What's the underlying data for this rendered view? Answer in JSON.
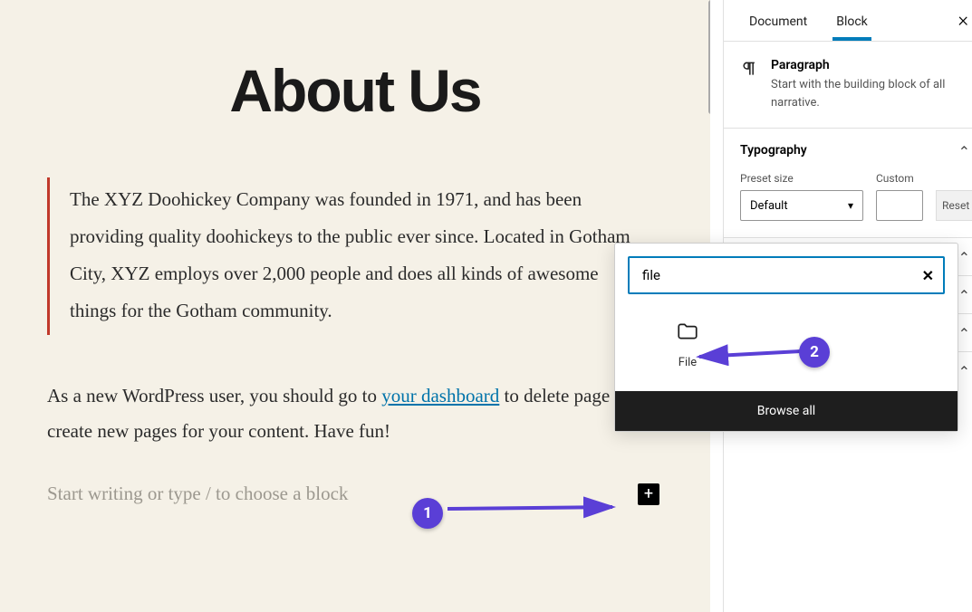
{
  "page": {
    "title": "About Us",
    "quote": "The XYZ Doohickey Company was founded in 1971, and has been providing quality doohickeys to the public ever since. Located in Gotham City, XYZ employs over 2,000 people and does all kinds of awesome things for the Gotham community.",
    "body_before_link": "As a new WordPress user, you should go to ",
    "body_link_text": "your dashboard",
    "body_after_link": " to delete page and create new pages for your content. Have fun!",
    "placeholder": "Start writing or type / to choose a block"
  },
  "sidebar": {
    "tabs": {
      "document": "Document",
      "block": "Block"
    },
    "block_name": "Paragraph",
    "block_desc": "Start with the building block of all narrative.",
    "typography": {
      "heading": "Typography",
      "preset_label": "Preset size",
      "preset_value": "Default",
      "custom_label": "Custom",
      "reset": "Reset"
    }
  },
  "inserter": {
    "search_value": "file",
    "result_label": "File",
    "browse_all": "Browse all"
  },
  "callouts": {
    "one": "1",
    "two": "2"
  }
}
